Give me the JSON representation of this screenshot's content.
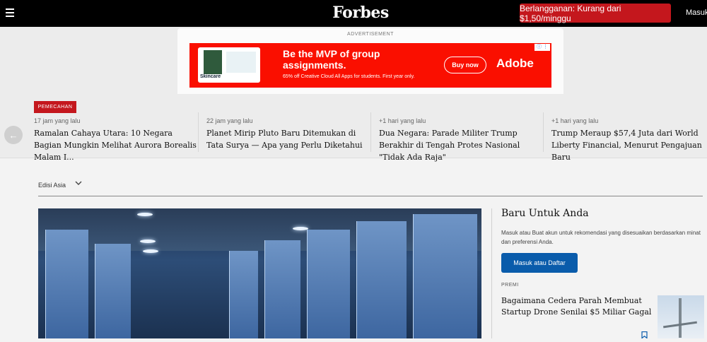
{
  "header": {
    "logo": "Forbes",
    "subscribe_label": "Berlangganan: Kurang dari $1,50/minggu",
    "signin_label": "Masuk",
    "menu_icon": "hamburger-menu-icon"
  },
  "ad": {
    "label": "ADVERTISEMENT",
    "headline": "Be the MVP of group assignments.",
    "subtext": "65% off Creative Cloud All Apps for students. First year only.",
    "cta": "Buy now",
    "brand": "Adobe",
    "book_brand": "Skincare",
    "info_icon": "ad-info-icon",
    "colors": {
      "background": "#fa0f00"
    }
  },
  "ticker": {
    "badge": "PEMECAHAN",
    "prev_icon": "arrow-left-icon",
    "items": [
      {
        "time": "17 jam yang lalu",
        "headline": "Ramalan Cahaya Utara: 10 Negara Bagian Mungkin Melihat Aurora Borealis Malam I..."
      },
      {
        "time": "22 jam yang lalu",
        "headline": "Planet Mirip Pluto Baru Ditemukan di Tata Surya — Apa yang Perlu Diketahui"
      },
      {
        "time": "+1 hari yang lalu",
        "headline": "Dua Negara: Parade Militer Trump Berakhir di Tengah Protes Nasional \"Tidak Ada Raja\""
      },
      {
        "time": "+1 hari yang lalu",
        "headline": "Trump Meraup $57,4 Juta dari World Liberty Financial, Menurut Pengajuan Baru"
      }
    ]
  },
  "edition": {
    "label": "Edisi Asia",
    "chevron": "chevron-down-icon"
  },
  "sidebar": {
    "title": "Baru Untuk Anda",
    "description": "Masuk atau Buat akun untuk rekomendasi yang disesuaikan berdasarkan minat dan preferensi Anda.",
    "login_label": "Masuk atau Daftar",
    "premium_label": "PREMI",
    "promo_headline": "Bagaimana Cedera Parah Membuat Startup Drone Senilai $5 Miliar Gagal",
    "bookmark_icon": "bookmark-icon"
  },
  "colors": {
    "brand_red": "#c4171d",
    "button_blue": "#0a5cab"
  }
}
